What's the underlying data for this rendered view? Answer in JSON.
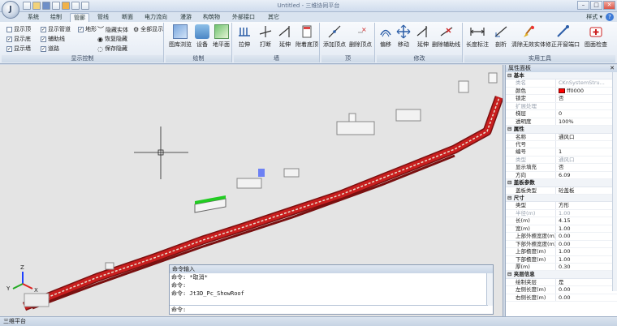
{
  "window": {
    "title": "Untitled - 三维协同平台",
    "app_button": "J"
  },
  "quick_access": [
    "new-icon",
    "open-icon",
    "save-icon",
    "undo-icon",
    "redo-icon",
    "print-icon",
    "blank-icon"
  ],
  "window_controls": {
    "minimize": "–",
    "maximize": "□",
    "close": "✕"
  },
  "tabs": [
    "系统",
    "绘制",
    "管廊",
    "管线",
    "断面",
    "电力流向",
    "漫游",
    "构筑物",
    "外部接口",
    "其它"
  ],
  "active_tab": "管廊",
  "style_menu": "样式 ▾",
  "help": "?",
  "ribbon": {
    "display": {
      "label": "显示控制",
      "checks": [
        {
          "label": "显示顶",
          "on": false
        },
        {
          "label": "显示管道",
          "on": true
        },
        {
          "label": "地形",
          "on": true
        },
        {
          "label": "显示底",
          "on": true
        },
        {
          "label": "辅助线",
          "on": true
        },
        {
          "label": "显示墙",
          "on": true
        },
        {
          "label": "道路",
          "on": true
        }
      ],
      "extras": [
        "隐藏实体",
        "全部显示",
        "恢复隐藏",
        "保存隐藏"
      ]
    },
    "draw": {
      "label": "绘制",
      "buttons": [
        "图库浏览",
        "设备",
        "地平面"
      ]
    },
    "wall": {
      "label": "墙",
      "buttons": [
        "拉伸",
        "打断",
        "延伸",
        "附着底顶"
      ]
    },
    "top": {
      "label": "顶",
      "buttons": [
        "添加顶点",
        "删除顶点"
      ]
    },
    "modify": {
      "label": "修改",
      "buttons": [
        "偏移",
        "移动",
        "延伸",
        "删除辅助线"
      ]
    },
    "tools": {
      "label": "实用工具",
      "buttons": [
        "长度标注",
        "剖析",
        "清除无效实体",
        "修正开窗端口",
        "图面检查"
      ]
    }
  },
  "command": {
    "title": "命令输入",
    "lines": [
      "命令:    *取消*",
      "命令:",
      "命令:   Jt3D_Pc_ShowRoof"
    ],
    "input": "命令:"
  },
  "properties": {
    "title": "属性面板",
    "close": "✕",
    "sections": [
      {
        "name": "基本",
        "rows": [
          {
            "k": "类名",
            "v": "CKnSystemStru...",
            "grey": true
          },
          {
            "k": "颜色",
            "v": "ff0000",
            "swatch": true
          },
          {
            "k": "锁定",
            "v": "否"
          },
          {
            "k": "扩展处理",
            "v": "",
            "grey": true
          },
          {
            "k": "梯层",
            "v": "0"
          },
          {
            "k": "透明度",
            "v": "100%"
          }
        ]
      },
      {
        "name": "属性",
        "rows": [
          {
            "k": "名称",
            "v": "通风口"
          },
          {
            "k": "代号",
            "v": ""
          },
          {
            "k": "编号",
            "v": "1"
          },
          {
            "k": "类型",
            "v": "通风口",
            "grey": true
          },
          {
            "k": "显示填充",
            "v": "否"
          },
          {
            "k": "方向",
            "v": "6.09"
          }
        ]
      },
      {
        "name": "盖板参数",
        "rows": [
          {
            "k": "盖板类型",
            "v": "砼盖板"
          }
        ]
      },
      {
        "name": "尺寸",
        "rows": [
          {
            "k": "类型",
            "v": "方形"
          },
          {
            "k": "半径(m)",
            "v": "1.00",
            "grey": true
          },
          {
            "k": "长(m)",
            "v": "4.15"
          },
          {
            "k": "宽(m)",
            "v": "1.00"
          },
          {
            "k": "上部外檐宽度(m)",
            "v": "0.00"
          },
          {
            "k": "下部外檐宽度(m)",
            "v": "0.00"
          },
          {
            "k": "上部檐度(m)",
            "v": "1.00"
          },
          {
            "k": "下部檐度(m)",
            "v": "1.00"
          },
          {
            "k": "厚(m)",
            "v": "0.30"
          }
        ]
      },
      {
        "name": "夹层信息",
        "rows": [
          {
            "k": "绘制夹层",
            "v": "是"
          },
          {
            "k": "左侧长度(m)",
            "v": "0.00"
          },
          {
            "k": "右侧长度(m)",
            "v": "0.00"
          }
        ]
      }
    ]
  },
  "status": "三维平台",
  "axis_labels": {
    "x": "X",
    "y": "Y",
    "z": "Z"
  },
  "colors": {
    "tunnel": "#c81e1e",
    "highlight": "#22cc22",
    "accent": "#3d7ad6"
  }
}
